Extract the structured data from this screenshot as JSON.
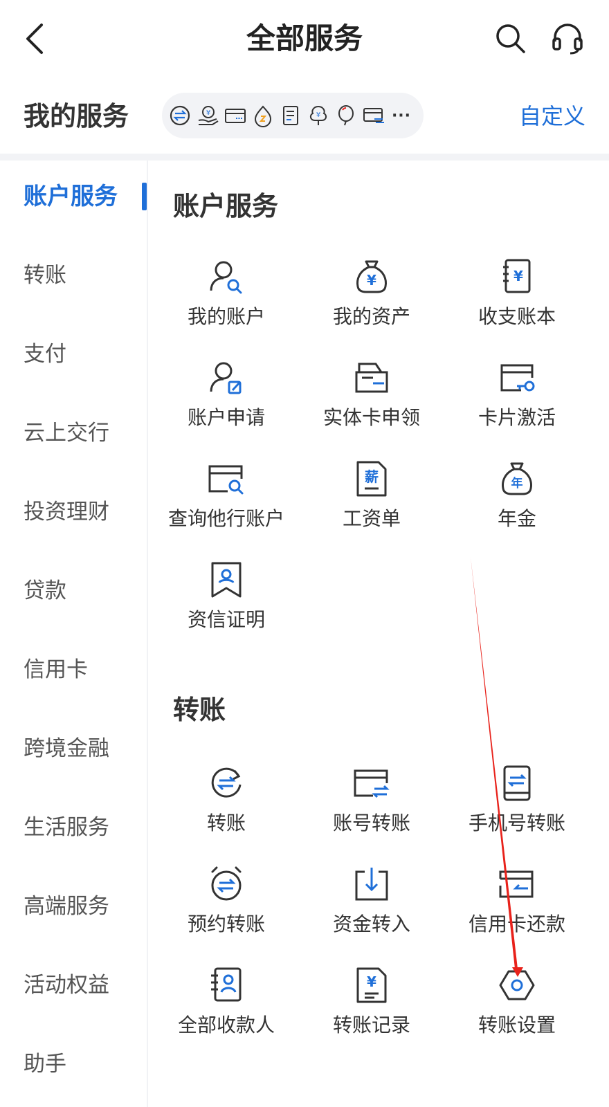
{
  "header": {
    "title": "全部服务",
    "back_icon": "chevron-left-icon",
    "search_icon": "search-icon",
    "support_icon": "headset-icon"
  },
  "my_services": {
    "title": "我的服务",
    "more": "···",
    "customize": "自定义",
    "icons": [
      "transfer-circle-icon",
      "hand-yen-icon",
      "card-icon",
      "flame-icon",
      "document-icon",
      "tree-yen-icon",
      "balloon-icon",
      "card-transfer-icon"
    ]
  },
  "sidebar": {
    "items": [
      {
        "label": "账户服务",
        "active": true
      },
      {
        "label": "转账"
      },
      {
        "label": "支付"
      },
      {
        "label": "云上交行"
      },
      {
        "label": "投资理财"
      },
      {
        "label": "贷款"
      },
      {
        "label": "信用卡"
      },
      {
        "label": "跨境金融"
      },
      {
        "label": "生活服务"
      },
      {
        "label": "高端服务"
      },
      {
        "label": "活动权益"
      },
      {
        "label": "助手"
      }
    ]
  },
  "sections": {
    "account": {
      "title": "账户服务",
      "items": [
        {
          "label": "我的账户",
          "icon": "user-search-icon"
        },
        {
          "label": "我的资产",
          "icon": "money-bag-icon"
        },
        {
          "label": "收支账本",
          "icon": "ledger-icon"
        },
        {
          "label": "账户申请",
          "icon": "user-edit-icon"
        },
        {
          "label": "实体卡申领",
          "icon": "card-box-icon"
        },
        {
          "label": "卡片激活",
          "icon": "card-key-icon"
        },
        {
          "label": "查询他行账户",
          "icon": "card-search-icon"
        },
        {
          "label": "工资单",
          "icon": "payslip-icon",
          "glyph": "薪"
        },
        {
          "label": "年金",
          "icon": "annuity-bag-icon",
          "glyph": "年"
        },
        {
          "label": "资信证明",
          "icon": "certificate-icon"
        }
      ]
    },
    "transfer": {
      "title": "转账",
      "items": [
        {
          "label": "转账",
          "icon": "transfer-icon"
        },
        {
          "label": "账号转账",
          "icon": "card-transfer-icon"
        },
        {
          "label": "手机号转账",
          "icon": "phone-transfer-icon"
        },
        {
          "label": "预约转账",
          "icon": "alarm-transfer-icon"
        },
        {
          "label": "资金转入",
          "icon": "inbox-arrow-icon"
        },
        {
          "label": "信用卡还款",
          "icon": "card-return-icon"
        },
        {
          "label": "全部收款人",
          "icon": "contacts-icon"
        },
        {
          "label": "转账记录",
          "icon": "receipt-yen-icon"
        },
        {
          "label": "转账设置",
          "icon": "hex-settings-icon"
        }
      ]
    }
  },
  "colors": {
    "accent": "#1f6fd8",
    "annotation": "#e8221b"
  }
}
